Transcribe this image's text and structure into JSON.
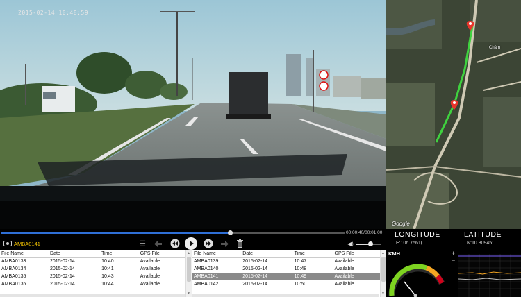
{
  "video": {
    "timestamp": "2015-02-14 10:48:59"
  },
  "map": {
    "google_label": "Google",
    "road_label": "Châm"
  },
  "player": {
    "time_readout": "00:00:40/00:01:00",
    "progress_fraction": 0.665,
    "current_clip": "AMBA0141",
    "volume_fraction": 0.55
  },
  "gps": {
    "longitude_label": "LONGITUDE",
    "latitude_label": "LATITUDE",
    "longitude_value": "E:106.7561(",
    "latitude_value": "N:10.80945:",
    "speed_unit": "KMH",
    "zoom_in": "+",
    "zoom_out": "−"
  },
  "file_table_left": {
    "headers": [
      "File Name",
      "Date",
      "Time",
      "GPS File"
    ],
    "rows": [
      [
        "AMBA0133",
        "2015-02-14",
        "10:40",
        "Available"
      ],
      [
        "AMBA0134",
        "2015-02-14",
        "10:41",
        "Available"
      ],
      [
        "AMBA0135",
        "2015-02-14",
        "10:43",
        "Available"
      ],
      [
        "AMBA0136",
        "2015-02-14",
        "10:44",
        "Available"
      ]
    ],
    "selected_index": -1
  },
  "file_table_right": {
    "headers": [
      "File Name",
      "Date",
      "Time",
      "GPS File"
    ],
    "rows": [
      [
        "AMBA0139",
        "2015-02-14",
        "10:47",
        "Available"
      ],
      [
        "AMBA0140",
        "2015-02-14",
        "10:48",
        "Available"
      ],
      [
        "AMBA0141",
        "2015-02-14",
        "10:49",
        "Available"
      ],
      [
        "AMBA0142",
        "2015-02-14",
        "10:50",
        "Available"
      ]
    ],
    "selected_index": 2
  },
  "colors": {
    "accent_blue": "#2f6fd6",
    "clip_yellow": "#f2c200",
    "route_green": "#3fd23f",
    "pin_red": "#e8342b"
  },
  "icons": {
    "camera": "camera-icon",
    "menu": "menu-icon",
    "prev": "arrow-left-icon",
    "rewind": "rewind-icon",
    "play": "play-icon",
    "forward": "fast-forward-icon",
    "next": "arrow-right-icon",
    "delete": "trash-icon",
    "volume": "volume-icon"
  }
}
